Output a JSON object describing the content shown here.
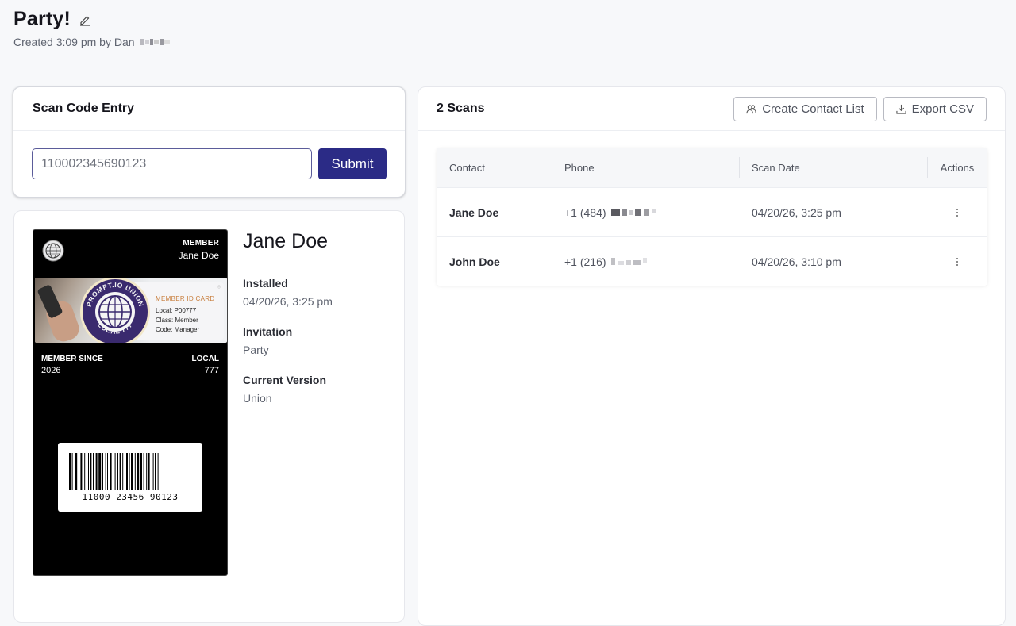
{
  "page": {
    "title": "Party!",
    "created_text": "Created 3:09 pm by Dan"
  },
  "scan_entry": {
    "title": "Scan Code Entry",
    "input_value": "110002345690123",
    "submit_label": "Submit"
  },
  "member_pass": {
    "header_label": "MEMBER",
    "header_value": "Jane Doe",
    "card_title": "MEMBER ID CARD",
    "card_lines": [
      "Local: P00777",
      "Class: Member",
      "Code: Manager"
    ],
    "member_since_label": "MEMBER SINCE",
    "member_since_value": "2026",
    "local_label": "LOCAL",
    "local_value": "777",
    "barcode_text": "11000 23456 90123"
  },
  "member_info": {
    "name": "Jane Doe",
    "fields": [
      {
        "label": "Installed",
        "value": "04/20/26, 3:25 pm"
      },
      {
        "label": "Invitation",
        "value": "Party"
      },
      {
        "label": "Current Version",
        "value": "Union"
      }
    ]
  },
  "scans": {
    "count_label": "2 Scans",
    "create_contact_list_label": "Create Contact List",
    "export_csv_label": "Export CSV",
    "columns": [
      "Contact",
      "Phone",
      "Scan Date",
      "Actions"
    ],
    "rows": [
      {
        "contact": "Jane Doe",
        "phone": "+1 (484)",
        "scan_date": "04/20/26, 3:25 pm"
      },
      {
        "contact": "John Doe",
        "phone": "+1 (216)",
        "scan_date": "04/20/26, 3:10 pm"
      }
    ]
  },
  "colors": {
    "primary": "#2b2b86",
    "background": "#f7f8fa",
    "seal": "#3a2a6e"
  },
  "icons": {
    "edit": "pencil-icon",
    "contacts": "users-icon",
    "export": "download-icon",
    "row_actions": "more-vertical-icon"
  }
}
